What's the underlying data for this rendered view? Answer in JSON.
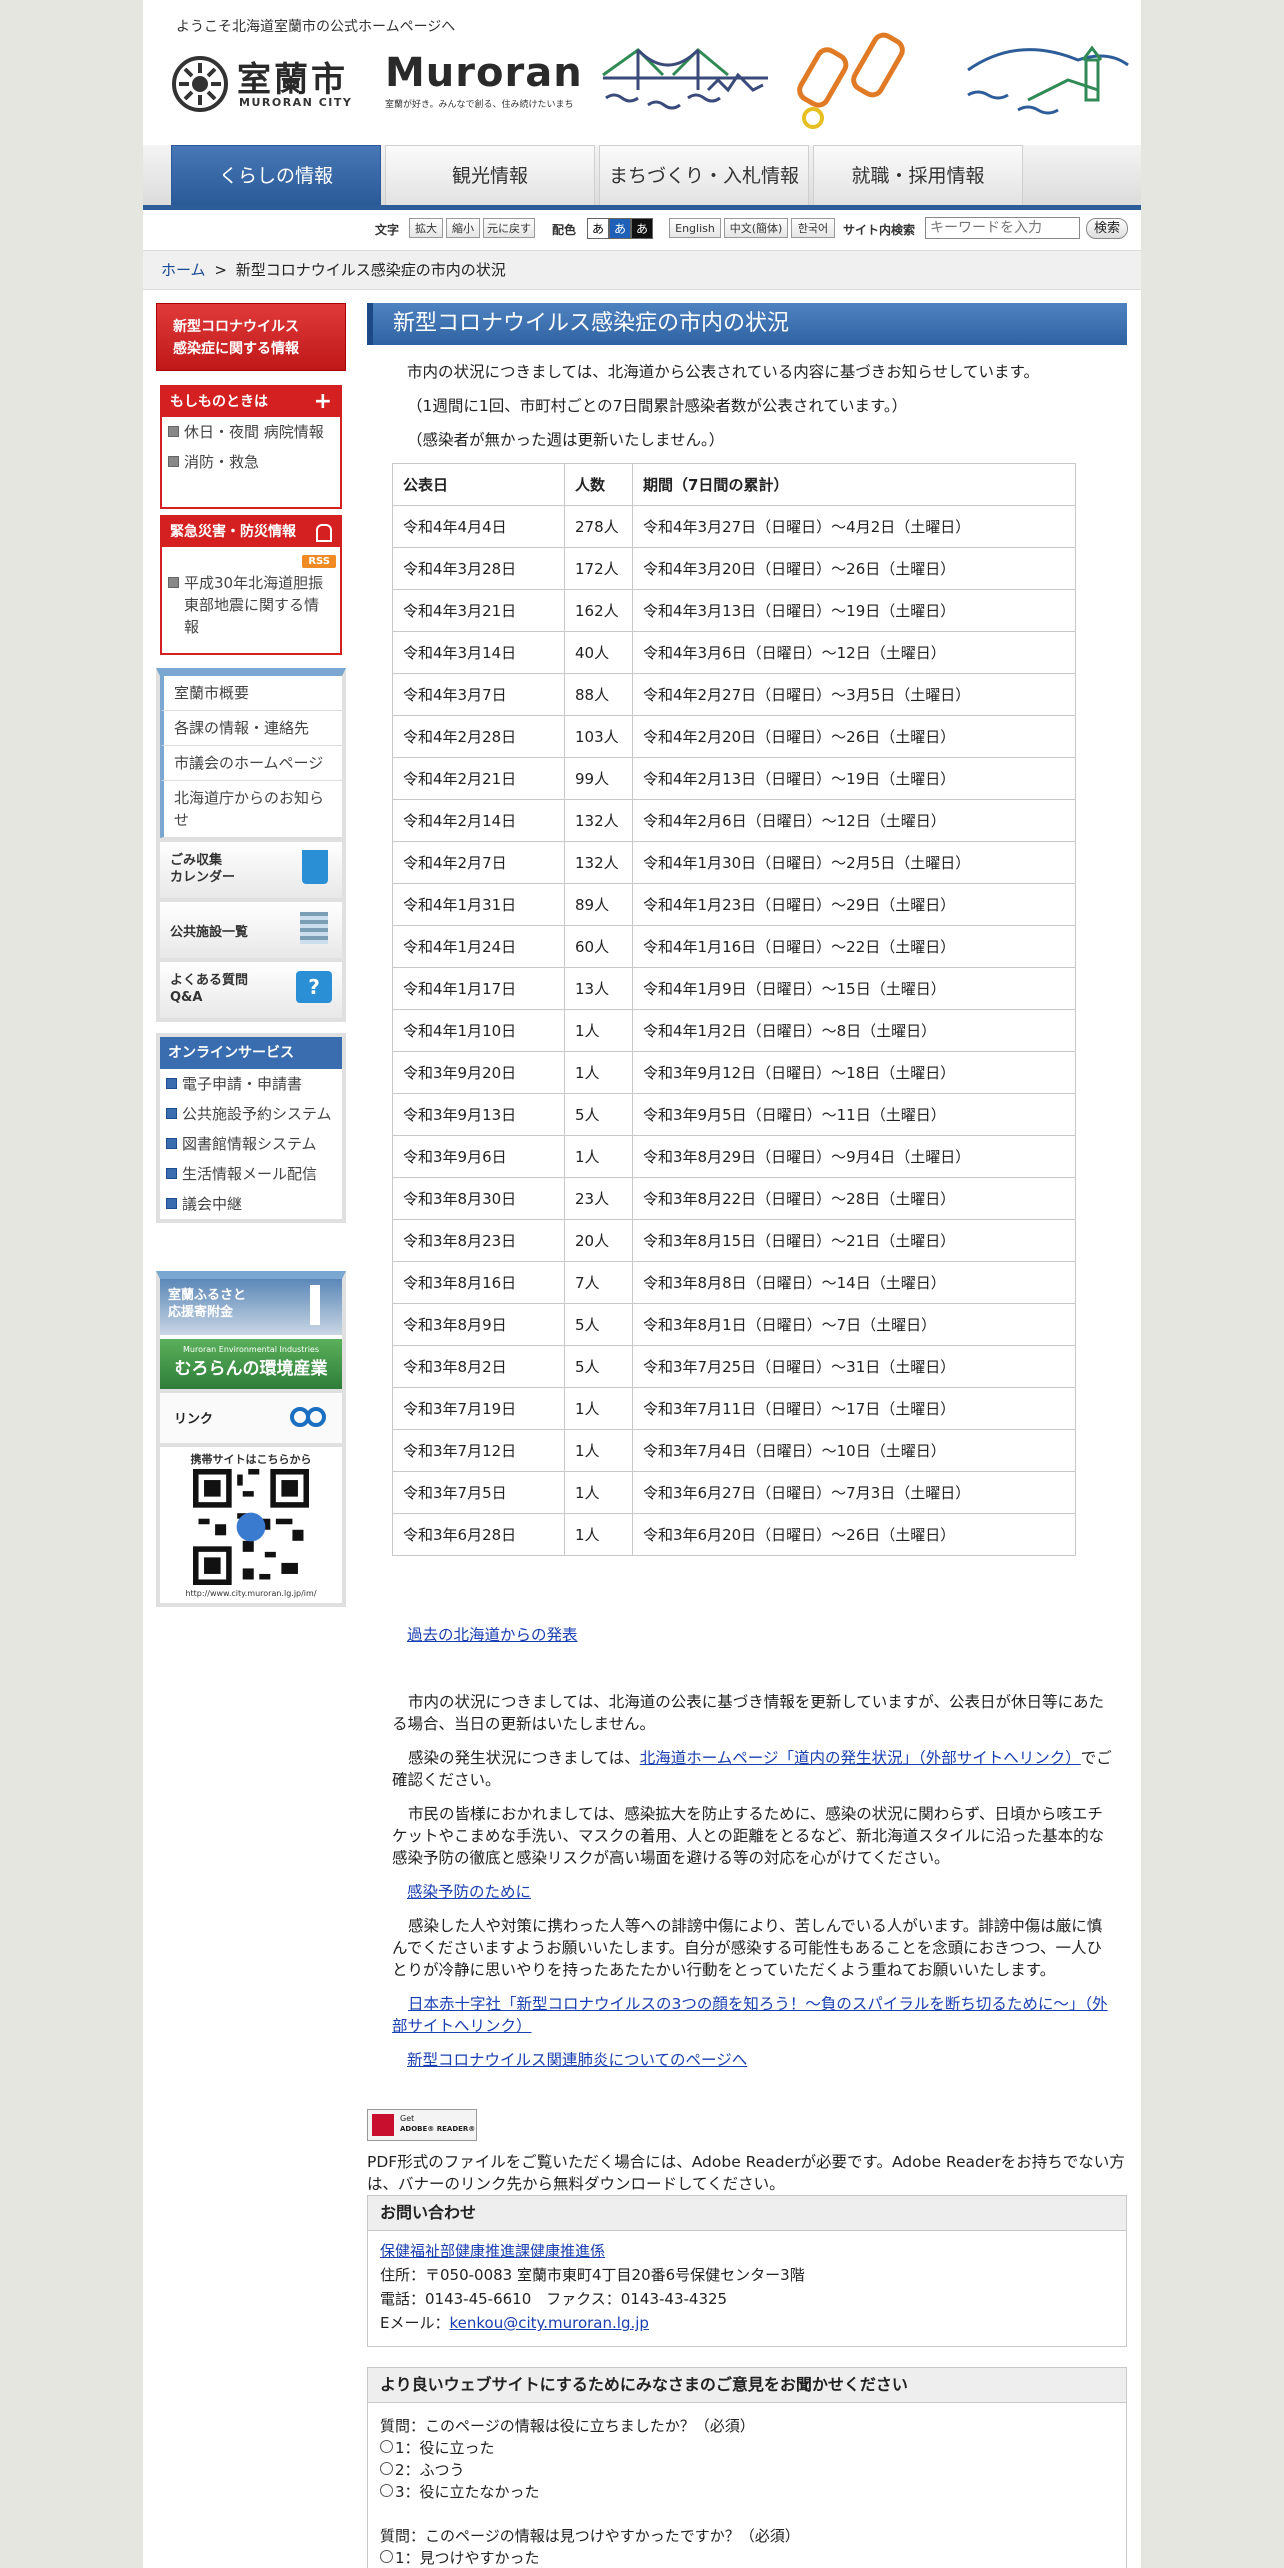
{
  "header": {
    "welcome": "ようこそ北海道室蘭市の公式ホームページへ",
    "logo_jp": "室蘭市",
    "logo_en_small": "MURORAN CITY",
    "logo_en": "Muroran",
    "slogan": "室蘭が好き。みんなで創る、住み続けたいまち"
  },
  "nav": {
    "tabs": [
      {
        "label": "くらしの情報"
      },
      {
        "label": "観光情報"
      },
      {
        "label": "まちづくり・入札情報"
      },
      {
        "label": "就職・採用情報"
      }
    ]
  },
  "toolbar": {
    "text_label": "文字",
    "zoom_in": "拡大",
    "zoom_out": "縮小",
    "reset": "元に戻す",
    "color_label": "配色",
    "color_a1": "あ",
    "color_a2": "あ",
    "color_a3": "あ",
    "lang_en": "English",
    "lang_zh": "中文(簡体)",
    "lang_ko": "한국어",
    "search_label": "サイト内検索",
    "search_placeholder": "キーワードを入力",
    "search_button": "検索"
  },
  "breadcrumb": {
    "home": "ホーム",
    "separator": ">",
    "current": "新型コロナウイルス感染症の市内の状況"
  },
  "sidebar": {
    "corona_line1": "新型コロナウイルス",
    "corona_line2": "感染症に関する情報",
    "emergency_head": "もしものときは",
    "emergency_links": [
      "休日・夜間 病院情報",
      "消防・救急"
    ],
    "disaster_head": "緊急災害・防災情報",
    "rss": "RSS",
    "disaster_links": [
      "平成30年北海道胆振東部地震に関する情報"
    ],
    "menu_items": [
      "室蘭市概要",
      "各課の情報・連絡先",
      "市議会のホームページ",
      "北海道庁からのお知らせ"
    ],
    "banner_gomi_1": "ごみ収集",
    "banner_gomi_2": "カレンダー",
    "banner_facility": "公共施設一覧",
    "banner_faq_1": "よくある質問",
    "banner_faq_2": "Q&A",
    "online_head": "オンラインサービス",
    "online_links": [
      "電子申請・申請書",
      "公共施設予約システム",
      "図書館情報システム",
      "生活情報メール配信",
      "議会中継"
    ],
    "furusato_1": "室蘭ふるさと",
    "furusato_2": "応援寄附金",
    "env_small": "Muroran Environmental Industries",
    "env_big": "むろらんの環境産業",
    "link_banner": "リンク",
    "mobile_text": "携帯サイトはこちらから",
    "mobile_url": "http://www.city.muroran.lg.jp/im/"
  },
  "main": {
    "title": "新型コロナウイルス感染症の市内の状況",
    "intro1": "市内の状況につきましては、北海道から公表されている内容に基づきお知らせしています。",
    "intro2": "（1週間に1回、市町村ごとの7日間累計感染者数が公表されています。）",
    "intro3": "（感染者が無かった週は更新いたしません。）",
    "table_headers": [
      "公表日",
      "人数",
      "期間（7日間の累計）"
    ],
    "rows": [
      [
        "令和4年4月4日",
        "278人",
        "令和4年3月27日（日曜日）～4月2日（土曜日）"
      ],
      [
        "令和4年3月28日",
        "172人",
        "令和4年3月20日（日曜日）～26日（土曜日）"
      ],
      [
        "令和4年3月21日",
        "162人",
        "令和4年3月13日（日曜日）～19日（土曜日）"
      ],
      [
        "令和4年3月14日",
        "40人",
        "令和4年3月6日（日曜日）～12日（土曜日）"
      ],
      [
        "令和4年3月7日",
        "88人",
        "令和4年2月27日（日曜日）～3月5日（土曜日）"
      ],
      [
        "令和4年2月28日",
        "103人",
        "令和4年2月20日（日曜日）～26日（土曜日）"
      ],
      [
        "令和4年2月21日",
        "99人",
        "令和4年2月13日（日曜日）～19日（土曜日）"
      ],
      [
        "令和4年2月14日",
        "132人",
        "令和4年2月6日（日曜日）～12日（土曜日）"
      ],
      [
        "令和4年2月7日",
        "132人",
        "令和4年1月30日（日曜日）～2月5日（土曜日）"
      ],
      [
        "令和4年1月31日",
        "89人",
        "令和4年1月23日（日曜日）～29日（土曜日）"
      ],
      [
        "令和4年1月24日",
        "60人",
        "令和4年1月16日（日曜日）～22日（土曜日）"
      ],
      [
        "令和4年1月17日",
        "13人",
        "令和4年1月9日（日曜日）～15日（土曜日）"
      ],
      [
        "令和4年1月10日",
        "1人",
        "令和4年1月2日（日曜日）～8日（土曜日）"
      ],
      [
        "令和3年9月20日",
        "1人",
        "令和3年9月12日（日曜日）～18日（土曜日）"
      ],
      [
        "令和3年9月13日",
        "5人",
        "令和3年9月5日（日曜日）～11日（土曜日）"
      ],
      [
        "令和3年9月6日",
        "1人",
        "令和3年8月29日（日曜日）～9月4日（土曜日）"
      ],
      [
        "令和3年8月30日",
        "23人",
        "令和3年8月22日（日曜日）～28日（土曜日）"
      ],
      [
        "令和3年8月23日",
        "20人",
        "令和3年8月15日（日曜日）～21日（土曜日）"
      ],
      [
        "令和3年8月16日",
        "7人",
        "令和3年8月8日（日曜日）～14日（土曜日）"
      ],
      [
        "令和3年8月9日",
        "5人",
        "令和3年8月1日（日曜日）～7日（土曜日）"
      ],
      [
        "令和3年8月2日",
        "5人",
        "令和3年7月25日（日曜日）～31日（土曜日）"
      ],
      [
        "令和3年7月19日",
        "1人",
        "令和3年7月11日（日曜日）～17日（土曜日）"
      ],
      [
        "令和3年7月12日",
        "1人",
        "令和3年7月4日（日曜日）～10日（土曜日）"
      ],
      [
        "令和3年7月5日",
        "1人",
        "令和3年6月27日（日曜日）～7月3日（土曜日）"
      ],
      [
        "令和3年6月28日",
        "1人",
        "令和3年6月20日（日曜日）～26日（土曜日）"
      ]
    ],
    "past_link": "過去の北海道からの発表",
    "note1": "市内の状況につきましては、北海道の公表に基づき情報を更新していますが、公表日が休日等にあたる場合、当日の更新はいたしません。",
    "note2_prefix": "感染の発生状況につきましては、",
    "note2_link": "北海道ホームページ「道内の発生状況」（外部サイトへリンク）",
    "note2_suffix": "でご確認ください。",
    "note3": "市民の皆様におかれましては、感染拡大を防止するために、感染の状況に関わらず、日頃から咳エチケットやこまめな手洗い、マスクの着用、人との距離をとるなど、新北海道スタイルに沿った基本的な感染予防の徹底と感染リスクが高い場面を避ける等の対応を心がけてください。",
    "prevention_link": "感染予防のために",
    "note4": "感染した人や対策に携わった人等への誹謗中傷により、苦しんでいる人がいます。誹謗中傷は厳に慎んでくださいますようお願いいたします。自分が感染する可能性もあることを念頭におきつつ、一人ひとりが冷静に思いやりを持ったあたたかい行動をとっていただくよう重ねてお願いいたします。",
    "redcross_link": "日本赤十字社「新型コロナウイルスの3つの顔を知ろう！～負のスパイラルを断ち切るために～」（外部サイトへリンク）",
    "vaccine_link": "新型コロナウイルス関連肺炎についてのページへ",
    "adobe_badge_1": "Get",
    "adobe_badge_2": "ADOBE® READER®",
    "adobe_note": "PDF形式のファイルをご覧いただく場合には、Adobe Readerが必要です。Adobe Readerをお持ちでない方は、バナーのリンク先から無料ダウンロードしてください。"
  },
  "contact": {
    "head": "お問い合わせ",
    "dept": "保健福祉部健康推進課健康推進係",
    "address": "住所：〒050-0083 室蘭市東町4丁目20番6号保健センター3階",
    "phone": "電話：0143-45-6610　ファクス：0143-43-4325",
    "email_label": "Eメール：",
    "email": "kenkou@city.muroran.lg.jp"
  },
  "survey": {
    "head": "より良いウェブサイトにするためにみなさまのご意見をお聞かせください",
    "q1": "質問：このページの情報は役に立ちましたか？（必須）",
    "q1_options": [
      "1：役に立った",
      "2：ふつう",
      "3：役に立たなかった"
    ],
    "q2": "質問：このページの情報は見つけやすかったですか？（必須）",
    "q2_options": [
      "1：見つけやすかった"
    ]
  },
  "colors": {
    "nav_blue": "#2c5d99",
    "title_blue": "#3a6db0",
    "emergency_red": "#d42020",
    "link_blue": "#1a3fb0"
  }
}
